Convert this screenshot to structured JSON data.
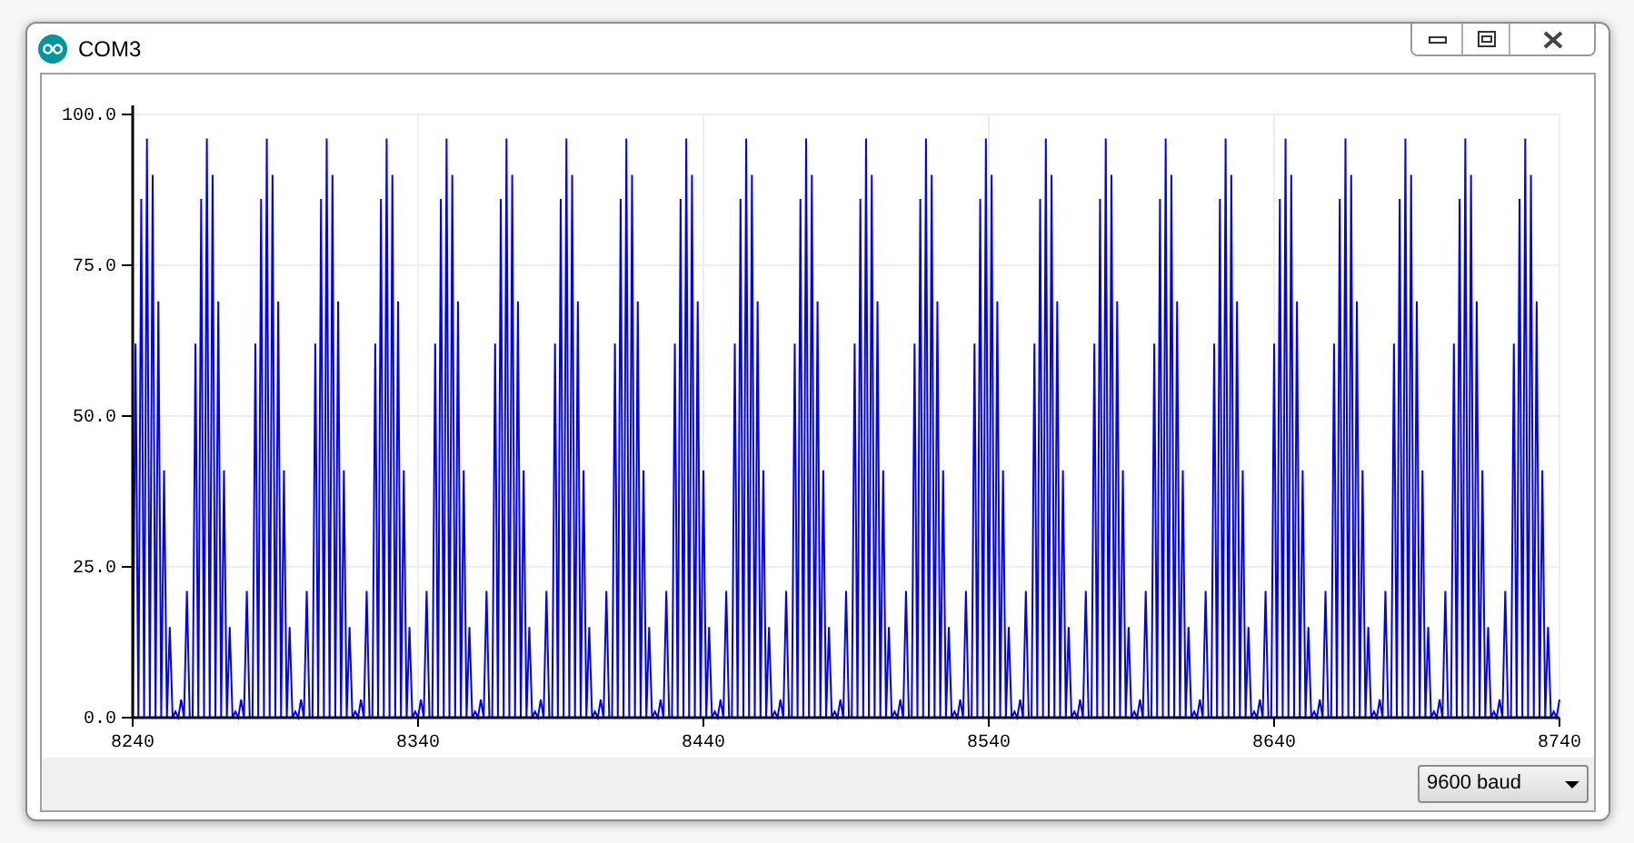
{
  "window": {
    "title": "COM3"
  },
  "plot": {
    "x_ticks": [
      "8240",
      "8340",
      "8440",
      "8540",
      "8640",
      "8740"
    ],
    "chart_data": {
      "type": "line",
      "grid": true,
      "ylim": [
        0,
        100
      ],
      "yticks": [
        {
          "value": 100,
          "label": "100.0"
        },
        {
          "value": 75,
          "label": "75.0"
        },
        {
          "value": 50,
          "label": "50.0"
        },
        {
          "value": 25,
          "label": "25.0"
        },
        {
          "value": 0,
          "label": "0.0"
        }
      ],
      "series": [
        {
          "color": "#0000ff",
          "values": [
            0,
            62,
            0,
            86,
            0,
            96,
            0,
            90,
            0,
            69,
            0,
            41,
            0,
            15,
            0,
            1,
            0,
            3,
            0,
            21,
            0,
            0,
            62,
            0,
            86,
            0,
            96,
            0,
            90,
            0,
            69,
            0,
            41,
            0,
            15,
            0,
            1,
            0,
            3,
            0,
            21,
            0,
            0,
            62,
            0,
            86,
            0,
            96,
            0,
            90,
            0,
            69,
            0,
            41,
            0,
            15,
            0,
            1,
            0,
            3,
            0,
            21,
            0,
            0,
            62,
            0,
            86,
            0,
            96,
            0,
            90,
            0,
            69,
            0,
            41,
            0,
            15,
            0,
            1,
            0,
            3,
            0,
            21,
            0,
            0,
            62,
            0,
            86,
            0,
            96,
            0,
            90,
            0,
            69,
            0,
            41,
            0,
            15,
            0,
            1,
            0,
            3,
            0,
            21,
            0,
            0,
            62,
            0,
            86,
            0,
            96,
            0,
            90,
            0,
            69,
            0,
            41,
            0,
            15,
            0,
            1,
            0,
            3,
            0,
            21,
            0,
            0,
            62,
            0,
            86,
            0,
            96,
            0,
            90,
            0,
            69,
            0,
            41,
            0,
            15,
            0,
            1,
            0,
            3,
            0,
            21,
            0,
            0,
            62,
            0,
            86,
            0,
            96,
            0,
            90,
            0,
            69,
            0,
            41,
            0,
            15,
            0,
            1,
            0,
            3,
            0,
            21,
            0,
            0,
            62,
            0,
            86,
            0,
            96,
            0,
            90,
            0,
            69,
            0,
            41,
            0,
            15,
            0,
            1,
            0,
            3,
            0,
            21,
            0,
            0,
            62,
            0,
            86,
            0,
            96,
            0,
            90,
            0,
            69,
            0,
            41,
            0,
            15,
            0,
            1,
            0,
            3,
            0,
            21,
            0,
            0,
            62,
            0,
            86,
            0,
            96,
            0,
            90,
            0,
            69,
            0,
            41,
            0,
            15,
            0,
            1,
            0,
            3,
            0,
            21,
            0,
            0,
            62,
            0,
            86,
            0,
            96,
            0,
            90,
            0,
            69,
            0,
            41,
            0,
            15,
            0,
            1,
            0,
            3,
            0,
            21,
            0,
            0,
            62,
            0,
            86,
            0,
            96,
            0,
            90,
            0,
            69,
            0,
            41,
            0,
            15,
            0,
            1,
            0,
            3,
            0,
            21,
            0,
            0,
            62,
            0,
            86,
            0,
            96,
            0,
            90,
            0,
            69,
            0,
            41,
            0,
            15,
            0,
            1,
            0,
            3,
            0,
            21,
            0,
            0,
            62,
            0,
            86,
            0,
            96,
            0,
            90,
            0,
            69,
            0,
            41,
            0,
            15,
            0,
            1,
            0,
            3,
            0,
            21,
            0,
            0,
            62,
            0,
            86,
            0,
            96,
            0,
            90,
            0,
            69,
            0,
            41,
            0,
            15,
            0,
            1,
            0,
            3,
            0,
            21,
            0,
            0,
            62,
            0,
            86,
            0,
            96,
            0,
            90,
            0,
            69,
            0,
            41,
            0,
            15,
            0,
            1,
            0,
            3,
            0,
            21,
            0,
            0,
            62,
            0,
            86,
            0,
            96,
            0,
            90,
            0,
            69,
            0,
            41,
            0,
            15,
            0,
            1,
            0,
            3,
            0,
            21,
            0,
            0,
            62,
            0,
            86,
            0,
            96,
            0,
            90,
            0,
            69,
            0,
            41,
            0,
            15,
            0,
            1,
            0,
            3,
            0,
            21,
            0,
            0,
            62,
            0,
            86,
            0,
            96,
            0,
            90,
            0,
            69,
            0,
            41,
            0,
            15,
            0,
            1,
            0,
            3,
            0,
            21,
            0,
            0,
            62,
            0,
            86,
            0,
            96,
            0,
            90,
            0,
            69,
            0,
            41,
            0,
            15,
            0,
            1,
            0,
            3,
            0,
            21,
            0,
            0,
            62,
            0,
            86,
            0,
            96,
            0,
            90,
            0,
            69,
            0,
            41,
            0,
            15,
            0,
            1,
            0,
            3,
            0,
            21,
            0,
            0,
            62,
            0,
            86,
            0,
            96,
            0,
            90,
            0,
            69,
            0,
            41,
            0,
            15,
            0,
            1,
            0,
            3,
            0,
            21,
            0,
            0,
            62,
            0,
            86,
            0,
            96,
            0,
            90,
            0,
            69,
            0,
            41,
            0,
            15,
            0,
            1,
            0,
            3
          ]
        }
      ]
    }
  },
  "baud_select": {
    "value": "9600 baud"
  }
}
